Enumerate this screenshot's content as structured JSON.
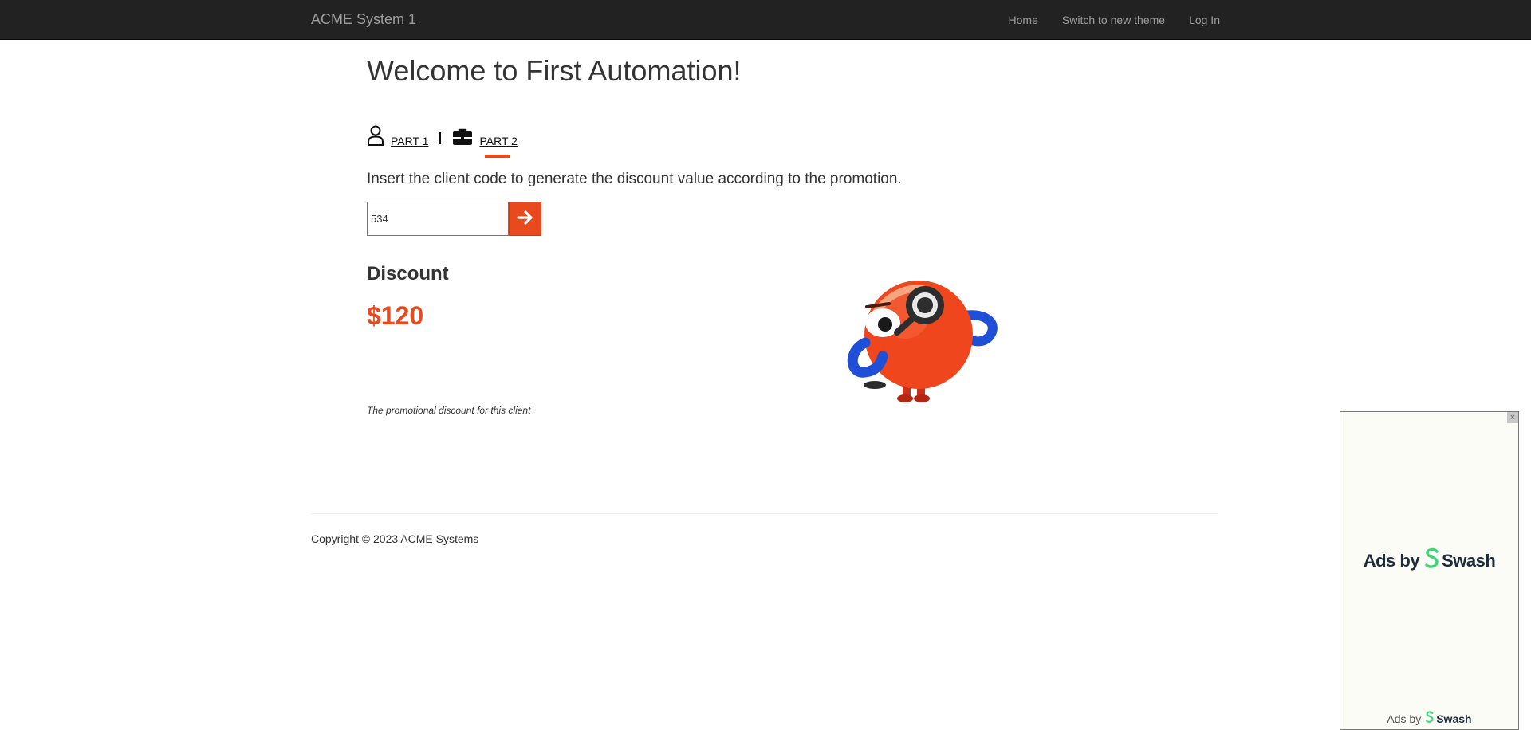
{
  "navbar": {
    "brand": "ACME System 1",
    "links": [
      "Home",
      "Switch to new theme",
      "Log In"
    ]
  },
  "page": {
    "title": "Welcome to First Automation!",
    "tabs": [
      {
        "label": "PART 1",
        "icon": "user-icon"
      },
      {
        "label": "PART 2",
        "icon": "briefcase-icon",
        "active": true
      }
    ],
    "instruction": "Insert the client code to generate the discount value according to the promotion.",
    "client_code_value": "534",
    "discount_heading": "Discount",
    "discount_value": "$120",
    "caption": "The promotional discount for this client"
  },
  "footer": {
    "copyright": "Copyright © 2023 ACME Systems"
  },
  "ad": {
    "main_prefix": "Ads by",
    "main_brand": "Swash",
    "footer_prefix": "Ads by",
    "footer_brand": "Swash",
    "close_label": "×"
  },
  "colors": {
    "accent": "#e8491d",
    "navbar_bg": "#222222",
    "swash_green": "#3ed47a"
  }
}
